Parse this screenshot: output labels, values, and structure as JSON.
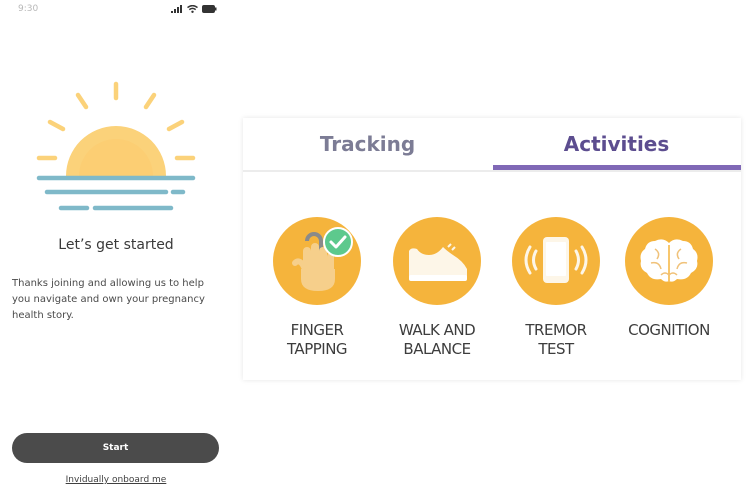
{
  "status_bar": {
    "time": "9:30"
  },
  "onboarding": {
    "title": "Let’s get started",
    "description": "Thanks joining and allowing us to help you navigate and own your pregnancy health story.",
    "start_button": "Start",
    "onboard_link": "Invidually onboard me"
  },
  "tabs": [
    {
      "label": "Tracking",
      "selected": false
    },
    {
      "label": "Activities",
      "selected": true
    }
  ],
  "activities": [
    {
      "line1": "FINGER",
      "line2": "TAPPING",
      "icon": "finger-tapping-icon",
      "completed": true
    },
    {
      "line1": "WALK AND",
      "line2": "BALANCE",
      "icon": "shoe-icon",
      "completed": false
    },
    {
      "line1": "TREMOR",
      "line2": "TEST",
      "icon": "vibrating-phone-icon",
      "completed": false
    },
    {
      "line1": "COGNITION",
      "line2": "",
      "icon": "brain-icon",
      "completed": false
    }
  ],
  "colors": {
    "activity_circle": "#f5b43c",
    "tab_accent": "#8068b6",
    "check_badge": "#5dc98d",
    "sun": "#fbd27a",
    "horizon": "#7fb9c9"
  }
}
